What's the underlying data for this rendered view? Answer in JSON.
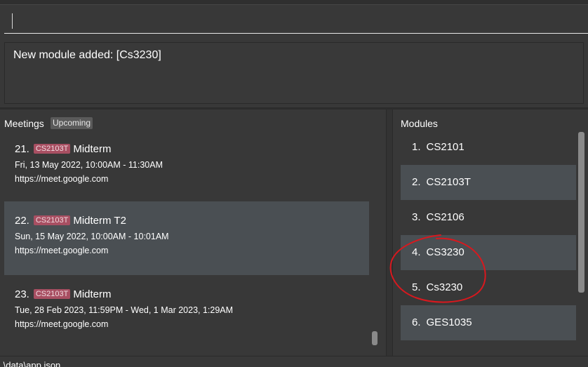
{
  "command_box": {
    "value": ""
  },
  "result": {
    "message": "New module added: [Cs3230]"
  },
  "meetings": {
    "title": "Meetings",
    "badge": "Upcoming",
    "items": [
      {
        "index": "21.",
        "tag": "CS2103T",
        "title": "Midterm",
        "time": "Fri, 13 May 2022, 10:00AM  -  11:30AM",
        "link": "https://meet.google.com",
        "selected": false
      },
      {
        "index": "22.",
        "tag": "CS2103T",
        "title": "Midterm T2",
        "time": "Sun, 15 May 2022, 10:00AM  -  10:01AM",
        "link": "https://meet.google.com",
        "selected": true
      },
      {
        "index": "23.",
        "tag": "CS2103T",
        "title": "Midterm",
        "time": "Tue, 28 Feb 2023, 11:59PM  -  Wed, 1 Mar 2023, 1:29AM",
        "link": "https://meet.google.com",
        "selected": false
      }
    ]
  },
  "modules": {
    "title": "Modules",
    "items": [
      {
        "index": "1.",
        "code": "CS2101"
      },
      {
        "index": "2.",
        "code": "CS2103T"
      },
      {
        "index": "3.",
        "code": "CS2106"
      },
      {
        "index": "4.",
        "code": "CS3230"
      },
      {
        "index": "5.",
        "code": "Cs3230"
      },
      {
        "index": "6.",
        "code": "GES1035"
      }
    ]
  },
  "status_bar": {
    "path": ".\\data\\app.json"
  },
  "colors": {
    "background": "#383838",
    "card_dark": "#383838",
    "card_light": "#4a4f53",
    "tag": "#a84f62",
    "annotation": "#d9181e"
  }
}
